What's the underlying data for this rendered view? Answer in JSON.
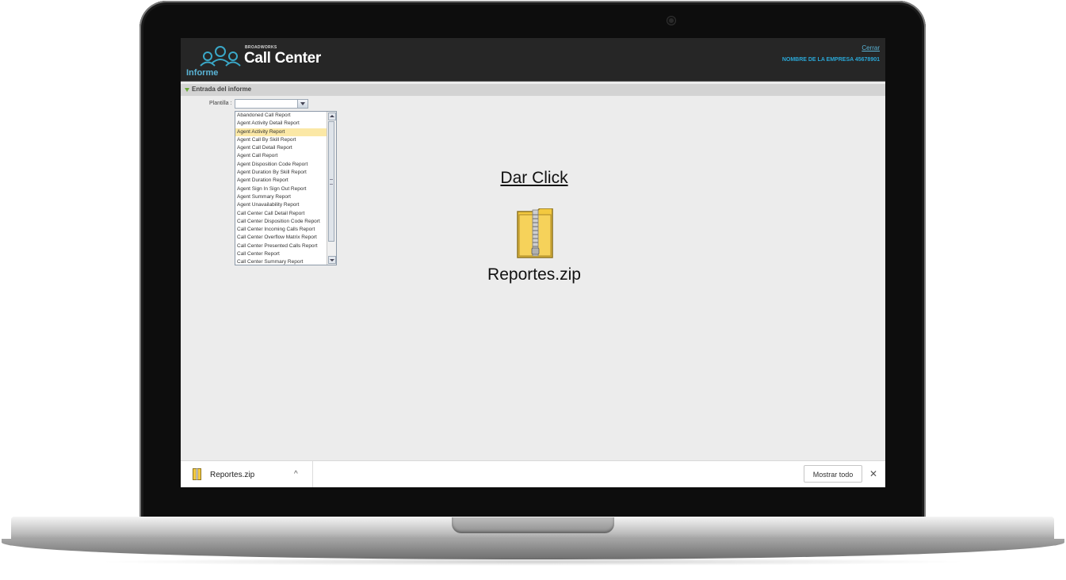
{
  "app": {
    "brand_small": "BROADWORKS",
    "brand_title": "Call Center",
    "section": "Informe",
    "logout": "Cerrar",
    "company": "NOMBRE DE LA EMPRESA 45678901"
  },
  "form": {
    "section_title": "Entrada del informe",
    "template_label": "Plantilla :",
    "template_value": "",
    "options": [
      "Abandoned Call Report",
      "Agent Activity Detail Report",
      "Agent Activity Report",
      "Agent Call By Skill Report",
      "Agent Call Detail Report",
      "Agent Call Report",
      "Agent Disposition Code Report",
      "Agent Duration By Skill Report",
      "Agent Duration Report",
      "Agent Sign In Sign Out Report",
      "Agent Summary Report",
      "Agent Unavailability Report",
      "Call Center Call Detail Report",
      "Call Center Disposition Code Report",
      "Call Center Incoming Calls Report",
      "Call Center Overflow Matrix Report",
      "Call Center Presented Calls Report",
      "Call Center Report",
      "Call Center Summary Report"
    ],
    "selected_index": 2
  },
  "overlay": {
    "click_text": "Dar Click",
    "file_name": "Reportes.zip",
    "icon": "zip-folder-icon"
  },
  "download_bar": {
    "file_name": "Reportes.zip",
    "chevron": "^",
    "show_all": "Mostrar todo",
    "close": "✕"
  },
  "colors": {
    "header_bg": "#262626",
    "accent": "#2aa7d6",
    "selected_option": "#fbe8a6",
    "section_arrow": "#6aa83a"
  }
}
